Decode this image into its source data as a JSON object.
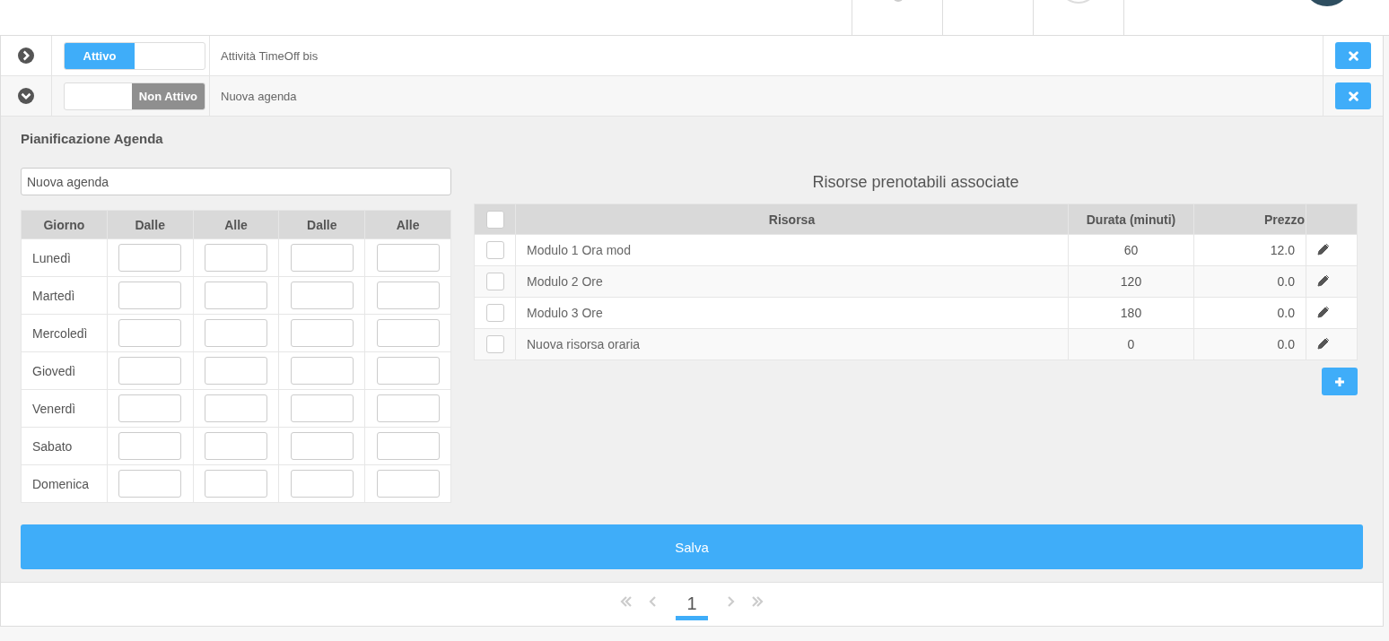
{
  "agendas": [
    {
      "expanded": false,
      "active": true,
      "toggle_label": "Attivo",
      "name": "Attività TimeOff bis"
    },
    {
      "expanded": true,
      "active": false,
      "toggle_label": "Non Attivo",
      "name": "Nuova agenda"
    }
  ],
  "planning": {
    "title": "Pianificazione Agenda",
    "name_value": "Nuova agenda",
    "schedule": {
      "columns": [
        "Giorno",
        "Dalle",
        "Alle",
        "Dalle",
        "Alle"
      ],
      "days": [
        "Lunedì",
        "Martedì",
        "Mercoledì",
        "Giovedì",
        "Venerdì",
        "Sabato",
        "Domenica"
      ]
    },
    "resources": {
      "title": "Risorse prenotabili associate",
      "select_all_checked": false,
      "columns": [
        "Risorsa",
        "Durata (minuti)",
        "Prezzo"
      ],
      "rows": [
        {
          "name": "Modulo 1 Ora mod",
          "duration": "60",
          "price": "12.0",
          "checked": false
        },
        {
          "name": "Modulo 2 Ore",
          "duration": "120",
          "price": "0.0",
          "checked": false
        },
        {
          "name": "Modulo 3 Ore",
          "duration": "180",
          "price": "0.0",
          "checked": false
        },
        {
          "name": "Nuova risorsa oraria",
          "duration": "0",
          "price": "0.0",
          "checked": false
        }
      ]
    },
    "save_label": "Salva"
  },
  "pagination": {
    "pages": [
      {
        "label": "1",
        "selected": true
      }
    ]
  }
}
